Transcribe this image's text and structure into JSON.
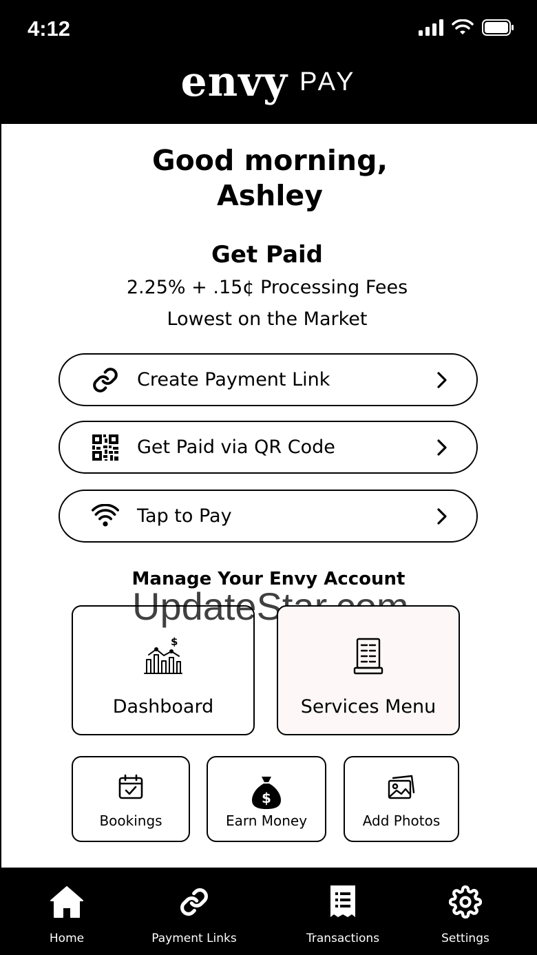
{
  "status_bar": {
    "time": "4:12"
  },
  "brand": {
    "logo_text": "envy",
    "product": "PAY"
  },
  "greeting": {
    "line1": "Good morning,",
    "line2": "Ashley"
  },
  "get_paid": {
    "title": "Get Paid",
    "fees": "2.25% + .15¢ Processing Fees",
    "tagline": "Lowest on the Market"
  },
  "actions": [
    {
      "label": "Create Payment Link",
      "icon": "link-icon"
    },
    {
      "label": "Get Paid via QR Code",
      "icon": "qr-code-icon"
    },
    {
      "label": "Tap to Pay",
      "icon": "contactless-icon"
    }
  ],
  "manage": {
    "title": "Manage Your Envy Account",
    "big_cards": [
      {
        "label": "Dashboard",
        "icon": "chart-icon"
      },
      {
        "label": "Services Menu",
        "icon": "menu-icon",
        "background": "#fdf7f7"
      }
    ],
    "small_cards": [
      {
        "label": "Bookings",
        "icon": "calendar-icon"
      },
      {
        "label": "Earn Money",
        "icon": "money-bag-icon"
      },
      {
        "label": "Add Photos",
        "icon": "photos-icon"
      }
    ]
  },
  "watermark": "UpdateStar.com",
  "tabs": [
    {
      "label": "Home",
      "icon": "home-icon"
    },
    {
      "label": "Payment Links",
      "icon": "link-icon"
    },
    {
      "label": "Transactions",
      "icon": "receipt-icon"
    },
    {
      "label": "Settings",
      "icon": "gear-icon"
    }
  ],
  "colors": {
    "header": "#000000",
    "background": "#ffffff",
    "services_card": "#fdf7f7"
  }
}
